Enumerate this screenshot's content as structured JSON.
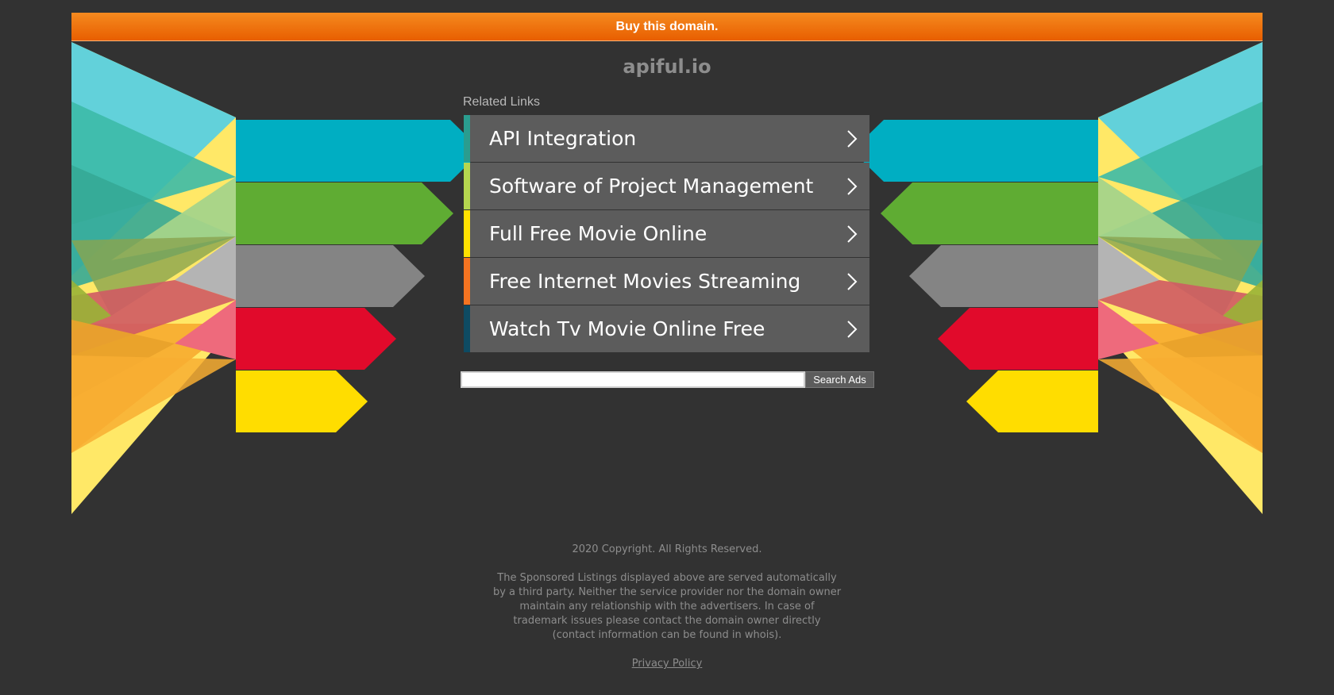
{
  "topbar": {
    "buy_label": "Buy this domain."
  },
  "domain": "apiful.io",
  "related": {
    "title": "Related Links",
    "links": [
      {
        "label": "API Integration",
        "color": "#2a9d8f"
      },
      {
        "label": "Software of Project Management",
        "color": "#b5d64f"
      },
      {
        "label": "Full Free Movie Online",
        "color": "#ffe100"
      },
      {
        "label": "Free Internet Movies Streaming",
        "color": "#f47421"
      },
      {
        "label": "Watch Tv Movie Online Free",
        "color": "#0e4b63"
      }
    ]
  },
  "search": {
    "button_label": "Search Ads",
    "value": ""
  },
  "footer": {
    "copyright": "2020 Copyright. All Rights Reserved.",
    "disclaimer": "The Sponsored Listings displayed above are served automatically by a third party. Neither the service provider nor the domain owner maintain any relationship with the advertisers. In case of trademark issues please contact the domain owner directly (contact information can be found in whois).",
    "privacy_label": "Privacy Policy"
  },
  "colors": {
    "background": "#323232",
    "accent": "#f58a1f",
    "cyan": "#00aec2",
    "green": "#5fac33",
    "gray": "#848484",
    "red": "#e10a2b",
    "yellow": "#ffdd00"
  }
}
